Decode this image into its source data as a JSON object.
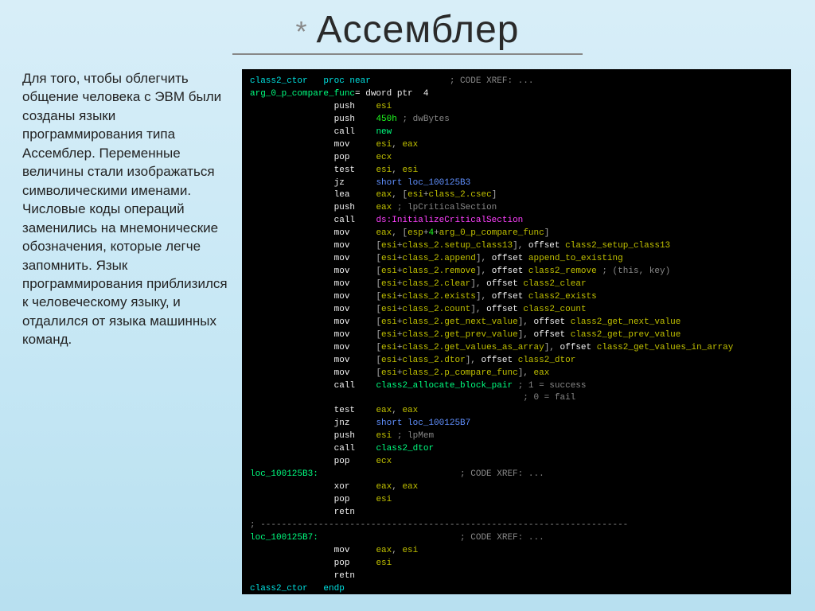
{
  "title": "Ассемблер",
  "body_text": "Для того, чтобы облегчить общение человека с ЭВМ были созданы языки программирования типа Ассемблер. Переменные величины стали изображаться символическими именами. Числовые коды операций заменились на мнемонические обозначения, которые легче запомнить. Язык программирования приблизился к человеческому языку, и отдалился от языка машинных команд.",
  "asm": {
    "header": {
      "name": "class2_ctor",
      "proc": "proc near",
      "cmt": "; CODE XREF: ..."
    },
    "arg": {
      "name": "arg_0_p_compare_func",
      "decl": "= dword ptr  4"
    },
    "body": [
      {
        "op": "push",
        "args": "esi"
      },
      {
        "op": "push",
        "args": "450h",
        "cmt": "; dwBytes"
      },
      {
        "op": "call",
        "args": "new",
        "argcls": "lbl"
      },
      {
        "op": "mov",
        "args": "esi, eax"
      },
      {
        "op": "pop",
        "args": "ecx"
      },
      {
        "op": "test",
        "args": "esi, esi"
      },
      {
        "op": "jz",
        "args": "short loc_100125B3",
        "argcls": "blue"
      },
      {
        "op": "lea",
        "args": "eax, [esi+class_2.csec]"
      },
      {
        "op": "push",
        "args": "eax",
        "cmt": "; lpCriticalSection"
      },
      {
        "op": "call",
        "args": "ds:InitializeCriticalSection",
        "argcls": "pink"
      },
      {
        "op": "mov",
        "args": "eax, [esp+4+arg_0_p_compare_func]"
      },
      {
        "op": "mov",
        "args": "[esi+class_2.setup_class13], offset class2_setup_class13"
      },
      {
        "op": "mov",
        "args": "[esi+class_2.append], offset append_to_existing"
      },
      {
        "op": "mov",
        "args": "[esi+class_2.remove], offset class2_remove ; (this, key)"
      },
      {
        "op": "mov",
        "args": "[esi+class_2.clear], offset class2_clear"
      },
      {
        "op": "mov",
        "args": "[esi+class_2.exists], offset class2_exists"
      },
      {
        "op": "mov",
        "args": "[esi+class_2.count], offset class2_count"
      },
      {
        "op": "mov",
        "args": "[esi+class_2.get_next_value], offset class2_get_next_value"
      },
      {
        "op": "mov",
        "args": "[esi+class_2.get_prev_value], offset class2_get_prev_value"
      },
      {
        "op": "mov",
        "args": "[esi+class_2.get_values_as_array], offset class2_get_values_in_array"
      },
      {
        "op": "mov",
        "args": "[esi+class_2.dtor], offset class2_dtor"
      },
      {
        "op": "mov",
        "args": "[esi+class_2.p_compare_func], eax"
      },
      {
        "op": "call",
        "args": "class2_allocate_block_pair",
        "argcls": "lbl",
        "cmt": "; 1 = success"
      },
      {
        "cmt_only": "; 0 = fail"
      },
      {
        "op": "test",
        "args": "eax, eax"
      },
      {
        "op": "jnz",
        "args": "short loc_100125B7",
        "argcls": "blue"
      },
      {
        "op": "push",
        "args": "esi",
        "cmt": "; lpMem"
      },
      {
        "op": "call",
        "args": "class2_dtor",
        "argcls": "lbl"
      },
      {
        "op": "pop",
        "args": "ecx"
      }
    ],
    "loc1": {
      "name": "loc_100125B3:",
      "cmt": "; CODE XREF: ...",
      "body": [
        {
          "op": "xor",
          "args": "eax, eax"
        },
        {
          "op": "pop",
          "args": "esi"
        },
        {
          "op": "retn",
          "args": ""
        }
      ]
    },
    "rule": "; ----------------------------------------------------------------------",
    "loc2": {
      "name": "loc_100125B7:",
      "cmt": "; CODE XREF: ...",
      "body": [
        {
          "op": "mov",
          "args": "eax, esi"
        },
        {
          "op": "pop",
          "args": "esi"
        },
        {
          "op": "retn",
          "args": ""
        }
      ]
    },
    "footer": {
      "name": "class2_ctor",
      "endp": "endp"
    }
  }
}
